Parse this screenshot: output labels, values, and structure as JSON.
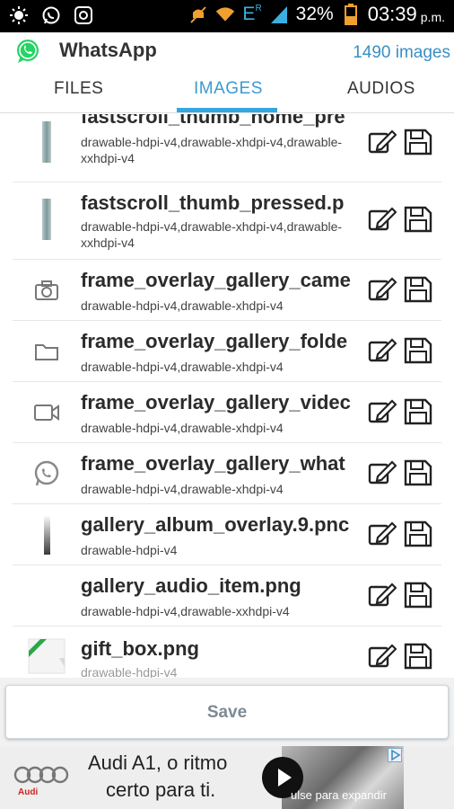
{
  "status_bar": {
    "network_letter": "E",
    "network_sub": "R",
    "battery": "32%",
    "time": "03:39",
    "ampm": "p.m."
  },
  "app_bar": {
    "title": "WhatsApp",
    "count": "1490 images"
  },
  "tabs": [
    {
      "label": "FILES"
    },
    {
      "label": "IMAGES"
    },
    {
      "label": "AUDIOS"
    }
  ],
  "active_tab": "IMAGES",
  "items": [
    {
      "name": "fastscroll_thumb_home_pre",
      "dirs": "drawable-hdpi-v4,drawable-xhdpi-v4,drawable-xxhdpi-v4",
      "thumb": "bar-thumb-icon"
    },
    {
      "name": "fastscroll_thumb_pressed.p",
      "dirs": "drawable-hdpi-v4,drawable-xhdpi-v4,drawable-xxhdpi-v4",
      "thumb": "bar-thumb-icon"
    },
    {
      "name": "frame_overlay_gallery_came",
      "dirs": "drawable-hdpi-v4,drawable-xhdpi-v4",
      "thumb": "camera-icon"
    },
    {
      "name": "frame_overlay_gallery_folde",
      "dirs": "drawable-hdpi-v4,drawable-xhdpi-v4",
      "thumb": "folder-icon"
    },
    {
      "name": "frame_overlay_gallery_videc",
      "dirs": "drawable-hdpi-v4,drawable-xhdpi-v4",
      "thumb": "video-camera-icon"
    },
    {
      "name": "frame_overlay_gallery_what",
      "dirs": "drawable-hdpi-v4,drawable-xhdpi-v4",
      "thumb": "whatsapp-icon"
    },
    {
      "name": "gallery_album_overlay.9.pnc",
      "dirs": "drawable-hdpi-v4",
      "thumb": "gradient-bar-icon"
    },
    {
      "name": "gallery_audio_item.png",
      "dirs": "drawable-hdpi-v4,drawable-xxhdpi-v4",
      "thumb": "none"
    },
    {
      "name": "gift_box.png",
      "dirs": "drawable-hdpi-v4",
      "thumb": "gift-box-icon"
    }
  ],
  "save": {
    "label": "Save"
  },
  "ad": {
    "brand": "Audi",
    "line1": "Audi A1, o ritmo",
    "line2": "certo para ti.",
    "expand": "ulse para expandir"
  },
  "colors": {
    "accent": "#33a7e0",
    "app_count": "#3b8fc3",
    "status_bar": "#000000",
    "whatsapp_green": "#25d366"
  }
}
